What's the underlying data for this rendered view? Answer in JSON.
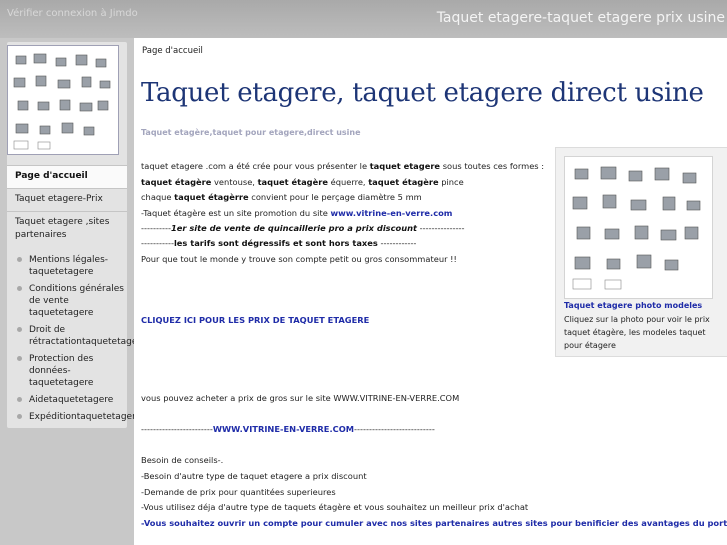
{
  "header": {
    "top_left": "Vérifier connexion à Jimdo",
    "site_title": "Taquet etagere-taquet etagere prix usine"
  },
  "nav": {
    "items": [
      {
        "label": "Page d'accueil"
      },
      {
        "label": "Taquet etagere-Prix"
      },
      {
        "label": "Taquet etagere ,sites partenaires"
      }
    ],
    "subitems": [
      {
        "label": "Mentions légales-taquetetagere"
      },
      {
        "label": "Conditions générales de vente taquetetagere"
      },
      {
        "label": "Droit de rétractationtaquetetagere"
      },
      {
        "label": "Protection des données-taquetetagere"
      },
      {
        "label": "Aidetaquetetagere"
      },
      {
        "label": "Expéditiontaquetetagere"
      }
    ]
  },
  "main": {
    "breadcrumb": "Page d'accueil",
    "title": "Taquet etagere, taquet etagere direct usine",
    "subtitle": "Taquet etagère,taquet pour etagere,direct usine",
    "intro": {
      "a": "taquet etagere .com a été crée pour vous présenter le ",
      "b": "taquet etagere",
      "c": " sous toutes ces formes :"
    },
    "forms": {
      "a": "taquet étagère",
      "b": " ventouse, ",
      "c": "taquet étagère",
      "d": " équerre, ",
      "e": "taquet étagère",
      "f": " pince"
    },
    "drill": {
      "a": "chaque ",
      "b": "taquet étagèrre",
      "c": " convient pour le perçage diamètre 5 mm"
    },
    "promo": {
      "a": "-Taquet étagère est un site promotion du site ",
      "link": "www.vitrine-en-verre.com"
    },
    "discount": {
      "a": "----------",
      "b": "1er site de vente de quincaillerie pro a prix discount",
      "c": " ---------------"
    },
    "prices": {
      "a": "-----------",
      "b": "les tarifs sont dégressifs et sont hors taxes",
      "c": " ------------"
    },
    "everyone": "Pour que tout le monde y trouve son compte petit ou gros consommateur !!",
    "cta": "CLIQUEZ ICI POUR LES PRIX DE TAQUET ETAGERE",
    "wholesale": "vous pouvez acheter a prix de gros sur le site WWW.VITRINE-EN-VERRE.COM",
    "dash_link": {
      "a": "------------------------",
      "link": "WWW.VITRINE-EN-VERRE.COM",
      "c": "---------------------------"
    },
    "advice": {
      "heading": "Besoin de conseils-.",
      "l1": "-Besoin d'autre type de taquet etagere a prix discount",
      "l2": "-Demande de prix pour quantitées superieures",
      "l3": "-Vous utilisez déja d'autre type de taquets étagère et vous souhaitez un meilleur prix d'achat",
      "l4": "-Vous souhaitez ouvrir un compte pour cumuler avec nos sites partenaires autres sites pour benificier des avantages du port gratuit"
    }
  },
  "side": {
    "title": "Taquet etagere photo modeles",
    "caption": "Cliquez sur la photo pour voir le prix taquet étagère, les modeles taquet pour étagere"
  },
  "colors": {
    "title_blue": "#1d3576",
    "link_blue": "#1f2ca8",
    "sidebar_bg": "#e3e3e3",
    "page_bg": "#c8c8c8"
  }
}
